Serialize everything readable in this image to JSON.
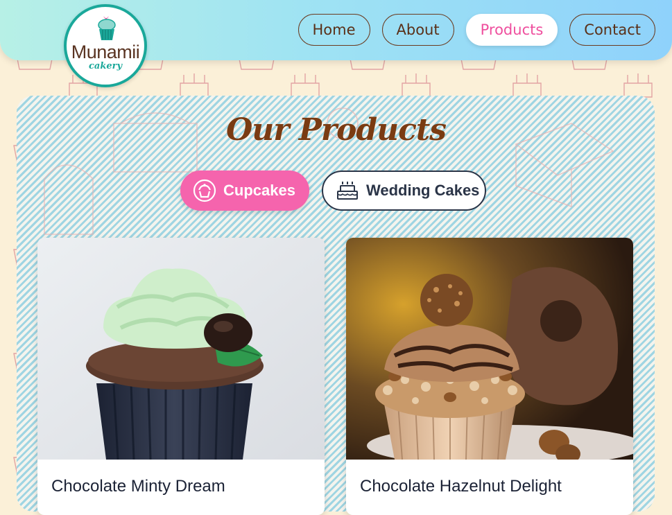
{
  "brand": {
    "name": "Munamii",
    "tagline": "cakery",
    "colors": {
      "teal": "#1aa89a",
      "brown": "#5a3422",
      "pink": "#ef4f9e"
    }
  },
  "nav": {
    "items": [
      {
        "label": "Home",
        "active": false
      },
      {
        "label": "About",
        "active": false
      },
      {
        "label": "Products",
        "active": true
      },
      {
        "label": "Contact",
        "active": false
      }
    ]
  },
  "products": {
    "title": "Our Products",
    "tabs": [
      {
        "label": "Cupcakes",
        "icon": "cupcake-icon",
        "active": true
      },
      {
        "label": "Wedding Cakes",
        "icon": "cake-icon",
        "active": false
      }
    ],
    "items": [
      {
        "name": "Chocolate Minty Dream"
      },
      {
        "name": "Chocolate Hazelnut Delight"
      }
    ]
  }
}
